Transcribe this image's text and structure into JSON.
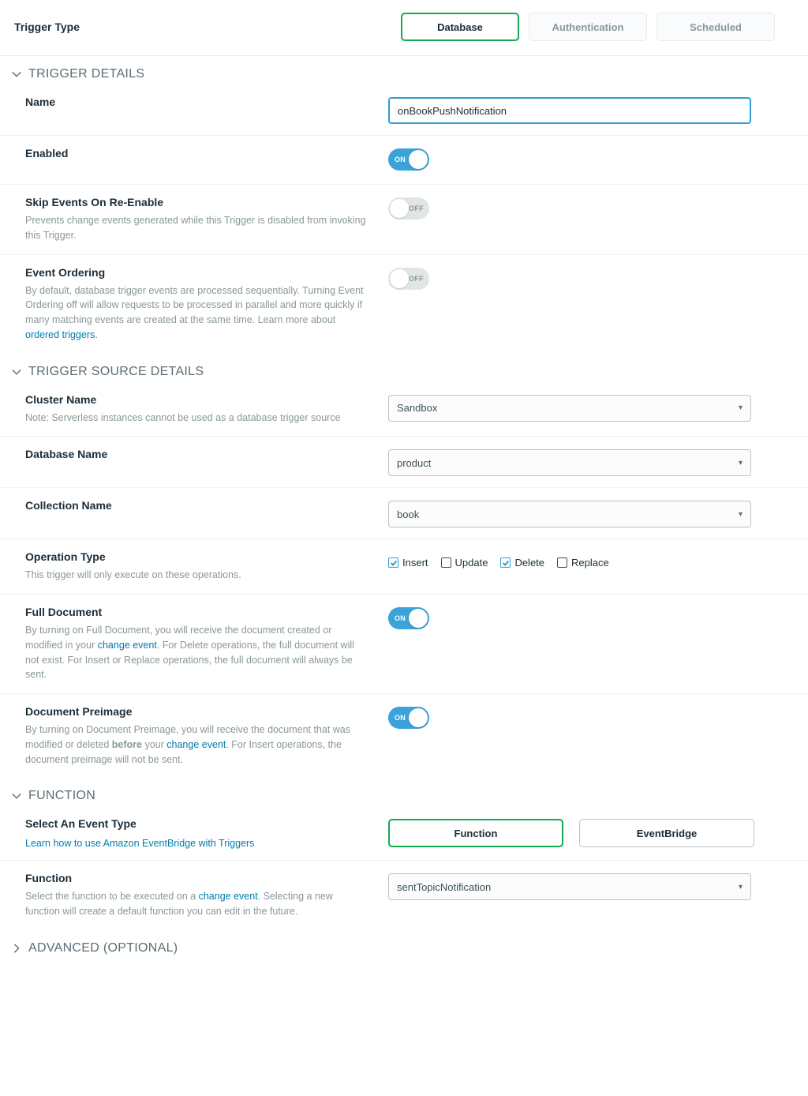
{
  "triggerType": {
    "label": "Trigger Type",
    "tabs": [
      "Database",
      "Authentication",
      "Scheduled"
    ],
    "active": "Database"
  },
  "sections": {
    "details": "TRIGGER DETAILS",
    "source": "TRIGGER SOURCE DETAILS",
    "function": "FUNCTION",
    "advanced": "ADVANCED (OPTIONAL)"
  },
  "fields": {
    "name": {
      "label": "Name",
      "value": "onBookPushNotification"
    },
    "enabled": {
      "label": "Enabled",
      "on": true,
      "onText": "ON"
    },
    "skip": {
      "label": "Skip Events On Re-Enable",
      "desc": "Prevents change events generated while this Trigger is disabled from invoking this Trigger.",
      "on": false,
      "offText": "OFF"
    },
    "ordering": {
      "label": "Event Ordering",
      "desc": "By default, database trigger events are processed sequentially. Turning Event Ordering off will allow requests to be processed in parallel and more quickly if many matching events are created at the same time. Learn more about ",
      "link": "ordered triggers.",
      "on": false,
      "offText": "OFF"
    },
    "cluster": {
      "label": "Cluster Name",
      "note": "Note: Serverless instances cannot be used as a database trigger source",
      "value": "Sandbox"
    },
    "database": {
      "label": "Database Name",
      "value": "product"
    },
    "collection": {
      "label": "Collection Name",
      "value": "book"
    },
    "operation": {
      "label": "Operation Type",
      "desc": "This trigger will only execute on these operations.",
      "options": [
        {
          "label": "Insert",
          "checked": true
        },
        {
          "label": "Update",
          "checked": false
        },
        {
          "label": "Delete",
          "checked": true
        },
        {
          "label": "Replace",
          "checked": false
        }
      ]
    },
    "fullDoc": {
      "label": "Full Document",
      "desc1": "By turning on Full Document, you will receive the document created or modified in your ",
      "link": "change event",
      "desc2": ". For Delete operations, the full document will not exist. For Insert or Replace operations, the full document will always be sent.",
      "on": true,
      "onText": "ON"
    },
    "preimage": {
      "label": "Document Preimage",
      "desc1": "By turning on Document Preimage, you will receive the document that was modified or deleted ",
      "bold": "before",
      "desc2": " your ",
      "link": "change event",
      "desc3": ". For Insert operations, the document preimage will not be sent.",
      "on": true,
      "onText": "ON"
    },
    "eventType": {
      "label": "Select An Event Type",
      "link": "Learn how to use Amazon EventBridge with Triggers",
      "tabs": [
        "Function",
        "EventBridge"
      ],
      "active": "Function"
    },
    "functionSel": {
      "label": "Function",
      "desc1": "Select the function to be executed on a ",
      "link": "change event",
      "desc2": ". Selecting a new function will create a default function you can edit in the future.",
      "value": "sentTopicNotification"
    }
  }
}
